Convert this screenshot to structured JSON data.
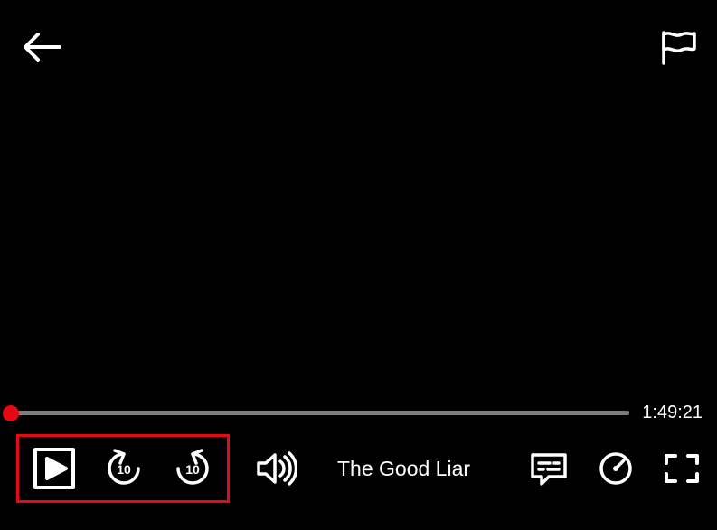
{
  "topbar": {
    "back_label": "Back",
    "flag_label": "Report"
  },
  "progress": {
    "percent": 0,
    "remaining": "1:49:21"
  },
  "title": "The Good Liar",
  "controls": {
    "play_label": "Play",
    "back10_label": "Back 10 seconds",
    "fwd10_label": "Forward 10 seconds",
    "volume_label": "Volume",
    "subtitles_label": "Subtitles & Audio",
    "speed_label": "Playback speed",
    "fullscreen_label": "Fullscreen"
  },
  "highlight": {
    "color": "#e50914"
  }
}
